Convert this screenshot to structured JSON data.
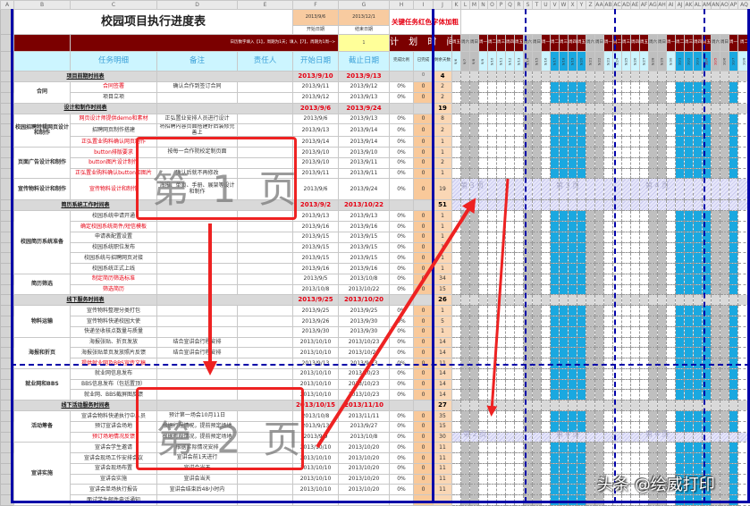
{
  "columns": [
    "A",
    "B",
    "C",
    "D",
    "E",
    "F",
    "G",
    "H",
    "I",
    "J",
    "K",
    "L",
    "M",
    "N",
    "O",
    "P",
    "Q",
    "R",
    "S",
    "T",
    "U",
    "V",
    "W",
    "X",
    "Y",
    "Z",
    "AA",
    "AB",
    "AC",
    "AD",
    "AE",
    "AF",
    "AG",
    "AH",
    "AI",
    "AJ",
    "AK",
    "AL",
    "AM",
    "AN",
    "AO",
    "AP",
    "AQ"
  ],
  "header": {
    "title": "校园项目执行进度表",
    "start_date": "2013/9/6",
    "start_label": "开始日期",
    "end_date": "2013/12/1",
    "end_label": "结束日期",
    "key_note": "关键任务红色字体加粗",
    "hint": "日历数字填入【1】，周期为1天；填入【7】，周期为1周-->",
    "period_value": "1",
    "plan_label": "计 划 时 间"
  },
  "col_headers": {
    "task": "任务明细",
    "note": "备注",
    "owner": "责任人",
    "start": "开始日期",
    "end": "截止日期",
    "pct": "完成比例",
    "done": "已完成",
    "remain": "剩余天数"
  },
  "gantt_days": [
    {
      "date": "9/6",
      "weekday": "周五",
      "type": "work"
    },
    {
      "date": "9/7",
      "weekday": "周六",
      "type": "weekend"
    },
    {
      "date": "9/8",
      "weekday": "周日",
      "type": "weekend"
    },
    {
      "date": "9/9",
      "weekday": "周一",
      "type": "work"
    },
    {
      "date": "9/10",
      "weekday": "周二",
      "type": "work"
    },
    {
      "date": "9/11",
      "weekday": "周三",
      "type": "work"
    },
    {
      "date": "9/12",
      "weekday": "周四",
      "type": "work"
    },
    {
      "date": "9/13",
      "weekday": "周五",
      "type": "work"
    },
    {
      "date": "9/14",
      "weekday": "周六",
      "type": "weekend"
    },
    {
      "date": "9/15",
      "weekday": "周日",
      "type": "weekend"
    },
    {
      "date": "9/16",
      "weekday": "周一",
      "type": "work"
    },
    {
      "date": "9/17",
      "weekday": "周二",
      "type": "holiday"
    },
    {
      "date": "9/18",
      "weekday": "周三",
      "type": "holiday"
    },
    {
      "date": "9/19",
      "weekday": "周四",
      "type": "holiday"
    },
    {
      "date": "9/20",
      "weekday": "周五",
      "type": "holiday"
    },
    {
      "date": "9/21",
      "weekday": "周六",
      "type": "weekend"
    },
    {
      "date": "9/22",
      "weekday": "周日",
      "type": "weekend"
    },
    {
      "date": "9/23",
      "weekday": "周一",
      "type": "work"
    },
    {
      "date": "9/24",
      "weekday": "周二",
      "type": "work"
    },
    {
      "date": "9/25",
      "weekday": "周三",
      "type": "work"
    },
    {
      "date": "9/26",
      "weekday": "周四",
      "type": "work"
    },
    {
      "date": "9/27",
      "weekday": "周五",
      "type": "work"
    },
    {
      "date": "9/28",
      "weekday": "周六",
      "type": "weekend"
    },
    {
      "date": "9/29",
      "weekday": "周日",
      "type": "weekend"
    },
    {
      "date": "9/30",
      "weekday": "周一",
      "type": "work"
    },
    {
      "date": "10/1",
      "weekday": "周二",
      "type": "holiday"
    },
    {
      "date": "10/2",
      "weekday": "周三",
      "type": "holiday"
    },
    {
      "date": "10/3",
      "weekday": "周四",
      "type": "holiday"
    },
    {
      "date": "10/4",
      "weekday": "周五",
      "type": "holiday",
      "red": true
    },
    {
      "date": "10/5",
      "weekday": "周六",
      "type": "weekend",
      "red": true
    },
    {
      "date": "10/6",
      "weekday": "周日",
      "type": "weekend"
    },
    {
      "date": "10/7",
      "weekday": "周一",
      "type": "holiday"
    },
    {
      "date": "10/8",
      "weekday": "周二",
      "type": "work"
    }
  ],
  "sections": [
    {
      "title": "项目前期时间表",
      "start": "2013/9/10",
      "end": "2013/9/13",
      "done": "0",
      "remain": "4",
      "groups": [
        {
          "name": "合同",
          "tasks": [
            {
              "task": "合同签署",
              "key": true,
              "note": "确认合作到签订合同",
              "start": "2013/9/11",
              "end": "2013/9/12",
              "pct": "0%",
              "done": "0",
              "remain": "2"
            },
            {
              "task": "项目立项",
              "note": "",
              "start": "2013/9/12",
              "end": "2013/9/13",
              "pct": "0%",
              "done": "0",
              "remain": "2"
            }
          ]
        }
      ]
    },
    {
      "title": "设计和制作时间表",
      "start": "2013/9/6",
      "end": "2013/9/24",
      "done": "",
      "remain": "19",
      "groups": [
        {
          "name": "校园招聘特辑网页设计和制作",
          "tasks": [
            {
              "task": "网页设计师提供demo和素材",
              "key": true,
              "note": "正弘置业安排人员进行设计",
              "start": "2013/9/6",
              "end": "2013/9/13",
              "pct": "0%",
              "done": "0",
              "remain": "8"
            },
            {
              "task": "招聘网页制作搭建",
              "note": "将招聘内容页面搭建好后装修完善上",
              "start": "2013/9/13",
              "end": "2013/9/14",
              "pct": "0%",
              "done": "0",
              "remain": "2"
            },
            {
              "task": "正弘置业购料确认网页制作",
              "key": true,
              "note": "",
              "start": "2013/9/14",
              "end": "2013/9/14",
              "pct": "0%",
              "done": "0",
              "remain": "1"
            }
          ]
        },
        {
          "name": "页面广告设计和制作",
          "tasks": [
            {
              "task": "button排版要求",
              "key": true,
              "note": "按每一合作院校定制页面",
              "start": "2013/9/10",
              "end": "2013/9/10",
              "pct": "0%",
              "done": "0",
              "remain": "1"
            },
            {
              "task": "button图片设计制作",
              "key": true,
              "note": "",
              "start": "2013/9/10",
              "end": "2013/9/11",
              "pct": "0%",
              "done": "0",
              "remain": "2"
            },
            {
              "task": "正弘置业购料确认button和图片",
              "key": true,
              "note": "确认后就不再修改",
              "start": "2013/9/11",
              "end": "2013/9/11",
              "pct": "0%",
              "done": "0",
              "remain": "1"
            }
          ]
        },
        {
          "name": "宣传物料设计和制作",
          "tall": true,
          "tasks": [
            {
              "task": "宣传物料设计和制作",
              "key": true,
              "note": "海报、单页、手册、展架等设计和制作",
              "start": "2013/9/6",
              "end": "2013/9/24",
              "pct": "0%",
              "done": "0",
              "remain": "19",
              "hatch": true
            }
          ]
        }
      ]
    },
    {
      "title": "简历系统工作时间表",
      "start": "2013/9/2",
      "end": "2013/10/22",
      "done": "",
      "remain": "51",
      "hatch": true,
      "groups": [
        {
          "name": "校园简历系统准备",
          "tasks": [
            {
              "task": "校园系统申请开通",
              "note": "",
              "start": "2013/9/13",
              "end": "2013/9/13",
              "pct": "0%",
              "done": "0",
              "remain": "1"
            },
            {
              "task": "确定校园系统商件/短信模板",
              "key": true,
              "note": "",
              "start": "2013/9/16",
              "end": "2013/9/16",
              "pct": "0%",
              "done": "0",
              "remain": "1"
            },
            {
              "task": "申请表配置设置",
              "note": "",
              "start": "2013/9/15",
              "end": "2013/9/15",
              "pct": "0%",
              "done": "0",
              "remain": "1"
            },
            {
              "task": "校园系统职位发布",
              "note": "",
              "start": "2013/9/15",
              "end": "2013/9/15",
              "pct": "0%",
              "done": "0",
              "remain": "1"
            },
            {
              "task": "校园系统与招聘网页对接",
              "note": "",
              "start": "2013/9/15",
              "end": "2013/9/15",
              "pct": "0%",
              "done": "0",
              "remain": "1"
            },
            {
              "task": "校园系统正式上线",
              "note": "",
              "start": "2013/9/16",
              "end": "2013/9/16",
              "pct": "0%",
              "done": "0",
              "remain": "1"
            }
          ]
        },
        {
          "name": "简历筛选",
          "tasks": [
            {
              "task": "制定简历筛选标准",
              "key": true,
              "note": "",
              "start": "2013/9/5",
              "end": "2013/10/8",
              "pct": "0%",
              "done": "0",
              "remain": "34"
            },
            {
              "task": "筛选简历",
              "key": true,
              "note": "",
              "start": "2013/10/8",
              "end": "2013/10/22",
              "pct": "0%",
              "done": "0",
              "remain": "15"
            }
          ]
        }
      ]
    },
    {
      "title": "线下服务时间表",
      "start": "2013/9/25",
      "end": "2013/10/20",
      "done": "",
      "remain": "26",
      "groups": [
        {
          "name": "物料运输",
          "tasks": [
            {
              "task": "宣传物料整理分类打包",
              "note": "",
              "start": "2013/9/25",
              "end": "2013/9/25",
              "pct": "0%",
              "done": "0",
              "remain": "1"
            },
            {
              "task": "宣传物料快递校园大使",
              "note": "",
              "start": "2013/9/26",
              "end": "2013/9/30",
              "pct": "0%",
              "done": "0",
              "remain": "5"
            },
            {
              "task": "快递坐收核点数量与质量",
              "note": "",
              "start": "2013/9/30",
              "end": "2013/9/30",
              "pct": "0%",
              "done": "0",
              "remain": "1"
            }
          ]
        },
        {
          "name": "海报和折页",
          "tasks": [
            {
              "task": "海报张贴、折页发放",
              "note": "结合宣讲会行程安排",
              "start": "2013/10/10",
              "end": "2013/10/23",
              "pct": "0%",
              "done": "0",
              "remain": "14"
            },
            {
              "task": "海报张贴单页发放照片反馈",
              "note": "结合宣讲会行程安排",
              "start": "2013/10/10",
              "end": "2013/10/23",
              "pct": "0%",
              "done": "0",
              "remain": "14"
            },
            {
              "task": "提供就业网及BBS宣传文稿",
              "key": true,
              "note": "",
              "start": "2013/9/13",
              "end": "2013/9/23",
              "pct": "0%",
              "done": "0",
              "remain": "11"
            }
          ]
        },
        {
          "name": "就业网和BBS",
          "tasks": [
            {
              "task": "就业网信息发布",
              "note": "",
              "start": "2013/10/10",
              "end": "2013/10/23",
              "pct": "0%",
              "done": "0",
              "remain": "14"
            },
            {
              "task": "BBS信息发布（包括置顶）",
              "note": "",
              "start": "2013/10/10",
              "end": "2013/10/23",
              "pct": "0%",
              "done": "0",
              "remain": "14"
            },
            {
              "task": "就业网、BBS截屏图反馈",
              "note": "",
              "start": "2013/10/10",
              "end": "2013/10/23",
              "pct": "0%",
              "done": "0",
              "remain": "14"
            }
          ]
        }
      ]
    },
    {
      "title": "线下活动服务时间表",
      "start": "2013/10/15",
      "end": "2013/11/10",
      "done": "",
      "remain": "27",
      "groups": [
        {
          "name": "活动筹备",
          "tasks": [
            {
              "task": "宣讲会物料快递执行中人员",
              "note": "预计第一场会10月11日",
              "start": "2013/10/8",
              "end": "2013/11/11",
              "pct": "0%",
              "done": "0",
              "remain": "35"
            },
            {
              "task": "预订宣讲会场地",
              "note": "根据行程情况，提前预定场地",
              "start": "2013/9/13",
              "end": "2013/9/27",
              "pct": "0%",
              "done": "0",
              "remain": "15"
            },
            {
              "task": "预订场地情况反馈",
              "key": true,
              "note": "根据行程情况，提前预定场地",
              "start": "2013/9/9",
              "end": "2013/10/8",
              "pct": "0%",
              "done": "0",
              "remain": "30",
              "hatch": true
            }
          ]
        },
        {
          "name": "宣讲实施",
          "tasks": [
            {
              "task": "宣讲会学生邀请",
              "note": "根据实际情况安排",
              "start": "2013/10/10",
              "end": "2013/10/20",
              "pct": "0%",
              "done": "0",
              "remain": "11"
            },
            {
              "task": "宣讲会现场工作安排会议",
              "note": "宣讲会前1天进行",
              "start": "2013/10/10",
              "end": "2013/10/20",
              "pct": "0%",
              "done": "0",
              "remain": "11"
            },
            {
              "task": "宣讲会现场布置",
              "note": "宣讲会当天",
              "start": "2013/10/10",
              "end": "2013/10/20",
              "pct": "0%",
              "done": "0",
              "remain": "11"
            },
            {
              "task": "宣讲会实施",
              "note": "宣讲会当天",
              "start": "2013/10/10",
              "end": "2013/10/20",
              "pct": "0%",
              "done": "0",
              "remain": "11"
            },
            {
              "task": "宣讲会单场执行报告",
              "note": "宣讲会结束后48小时内",
              "start": "2013/10/10",
              "end": "2013/10/20",
              "pct": "0%",
              "done": "0",
              "remain": "11"
            },
            {
              "task": "面试学生邮件电话通知",
              "note": "",
              "start": "",
              "end": "",
              "pct": "",
              "done": "",
              "remain": ""
            }
          ]
        }
      ]
    }
  ],
  "page_markers": {
    "page1": "第 1 页",
    "page2": "第 2 页",
    "page3": "第 3 页",
    "page4": "第 4 页"
  },
  "watermark": "头条 @绘威打印",
  "colors": {
    "accent_red": "#e60012",
    "header_dark_red": "#7b0000",
    "holiday_blue": "#1aa8e0",
    "page_break_blue": "#0000a8"
  }
}
